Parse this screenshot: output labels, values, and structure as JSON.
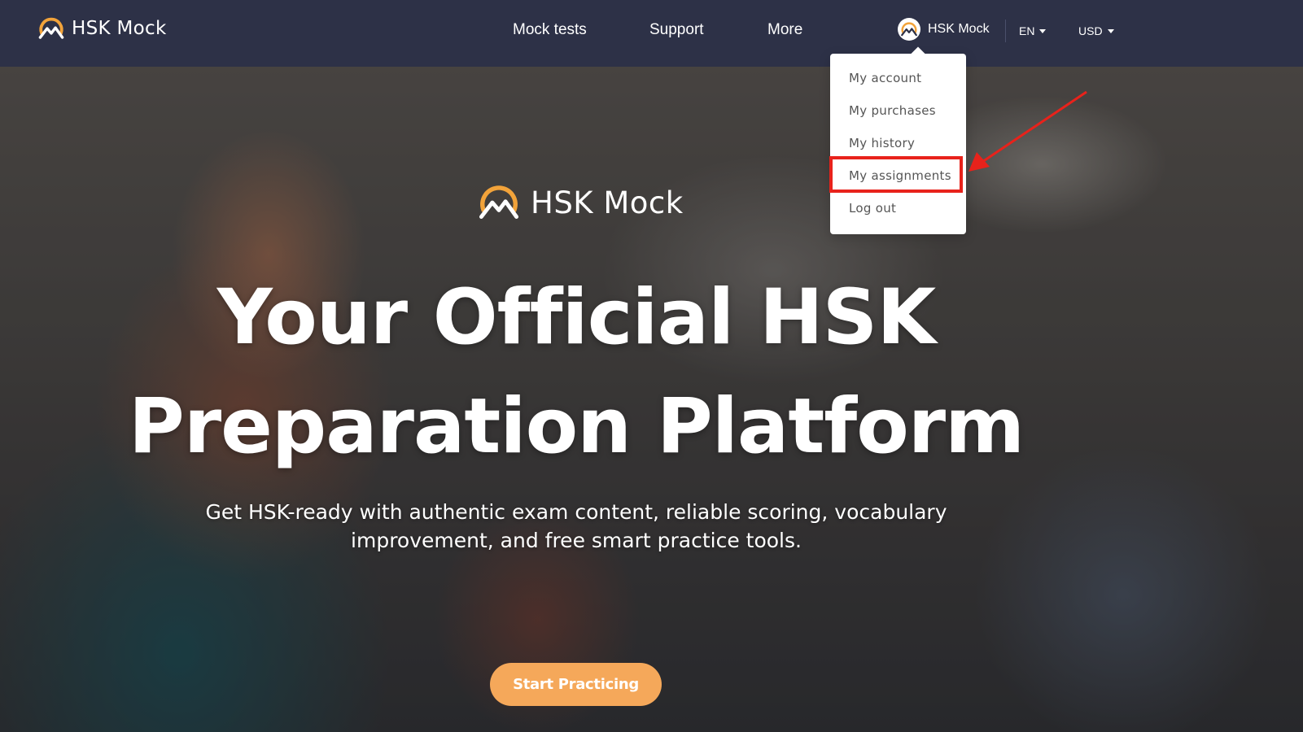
{
  "header": {
    "brand": "HSK Mock",
    "nav": [
      "Mock tests",
      "Support",
      "More"
    ],
    "user_name": "HSK Mock",
    "language": "EN",
    "currency": "USD"
  },
  "dropdown": {
    "items": [
      "My account",
      "My purchases",
      "My history",
      "My assignments",
      "Log out"
    ],
    "highlighted": "My assignments"
  },
  "hero": {
    "logo_text": "HSK Mock",
    "title_line1": "Your Official HSK",
    "title_line2": "Preparation Platform",
    "subtitle_line1": "Get HSK-ready with authentic exam content, reliable scoring, vocabulary",
    "subtitle_line2": "improvement, and free smart practice tools.",
    "cta": "Start Practicing"
  },
  "colors": {
    "nav_bg": "#2d3147",
    "accent": "#f5a85a",
    "logo_orange": "#f2a33a",
    "annotation": "#e8221b"
  },
  "icons": [
    "hsk-logo-icon",
    "avatar-icon",
    "caret-down-icon",
    "annotation-arrow"
  ]
}
